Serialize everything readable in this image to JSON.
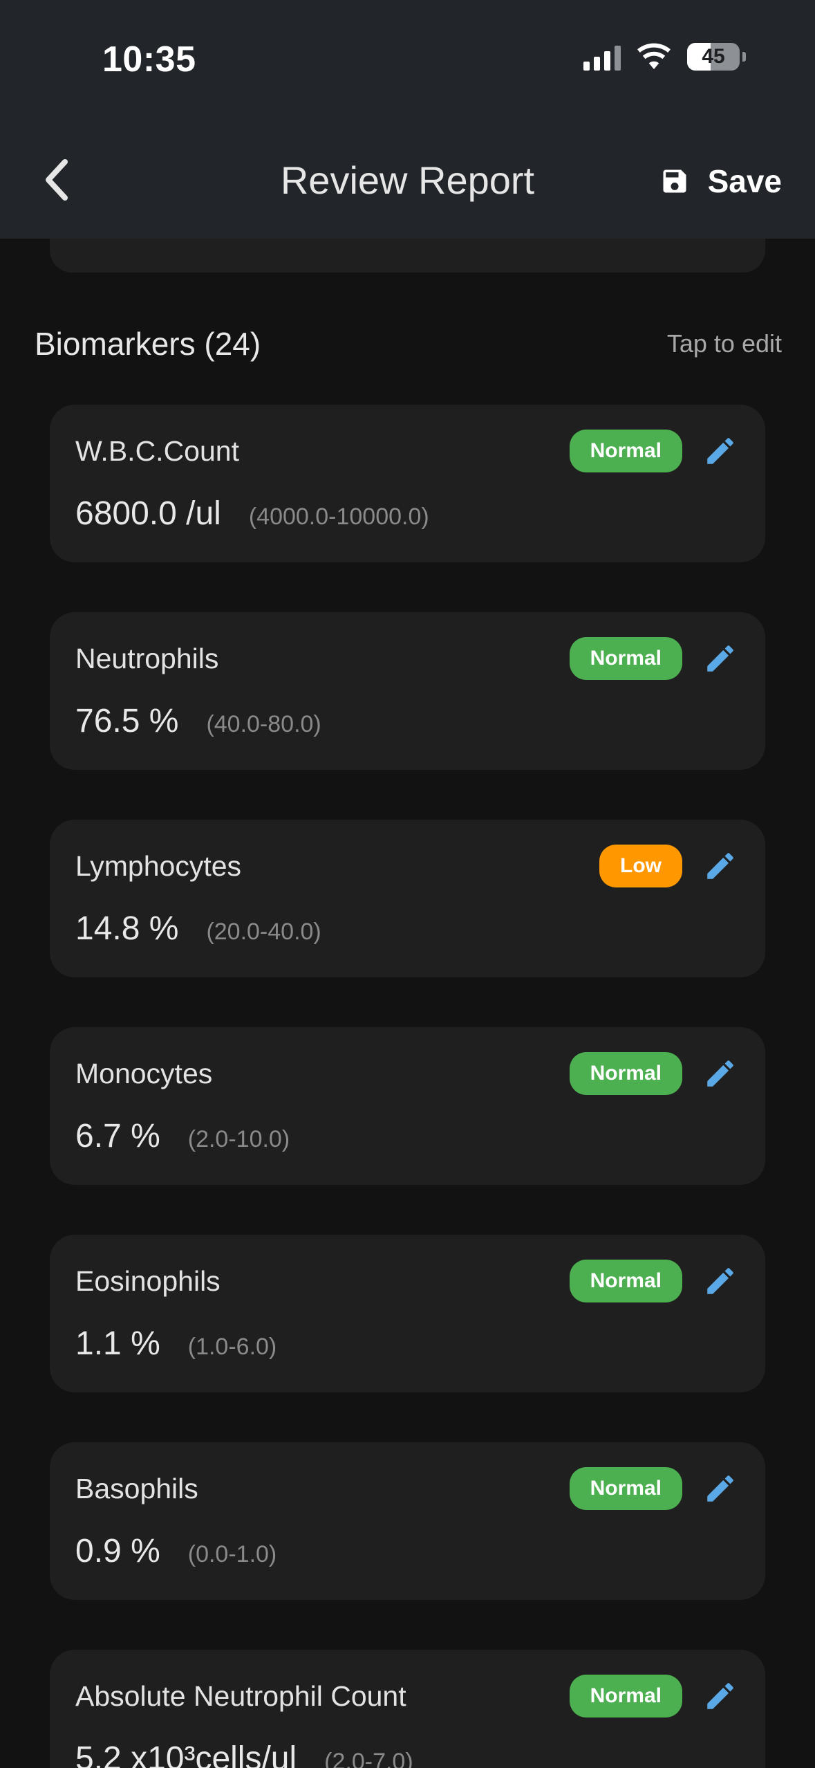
{
  "status_bar": {
    "time": "10:35",
    "battery": "45",
    "battery_level": 0.45,
    "icons": [
      "cellular-signal-icon",
      "wifi-icon",
      "battery-icon"
    ]
  },
  "nav": {
    "back_icon": "chevron-left-icon",
    "title": "Review Report",
    "save_icon": "floppy-disk-icon",
    "save_label": "Save"
  },
  "section": {
    "title": "Biomarkers (24)",
    "hint": "Tap to edit"
  },
  "colors": {
    "normal": "#4caf50",
    "low": "#ff9800",
    "edit_icon": "#5aa9e6",
    "card_bg": "#1f1f1f",
    "header_bg": "#22262b"
  },
  "biomarkers": [
    {
      "name": "W.B.C.Count",
      "value": "6800.0 /ul",
      "range": "(4000.0-10000.0)",
      "status": "Normal"
    },
    {
      "name": "Neutrophils",
      "value": "76.5 %",
      "range": "(40.0-80.0)",
      "status": "Normal"
    },
    {
      "name": "Lymphocytes",
      "value": "14.8 %",
      "range": "(20.0-40.0)",
      "status": "Low"
    },
    {
      "name": "Monocytes",
      "value": "6.7 %",
      "range": "(2.0-10.0)",
      "status": "Normal"
    },
    {
      "name": "Eosinophils",
      "value": "1.1 %",
      "range": "(1.0-6.0)",
      "status": "Normal"
    },
    {
      "name": "Basophils",
      "value": "0.9 %",
      "range": "(0.0-1.0)",
      "status": "Normal"
    },
    {
      "name": "Absolute Neutrophil Count",
      "value": "5.2 x10³cells/ul",
      "range": "(2.0-7.0)",
      "status": "Normal"
    }
  ]
}
